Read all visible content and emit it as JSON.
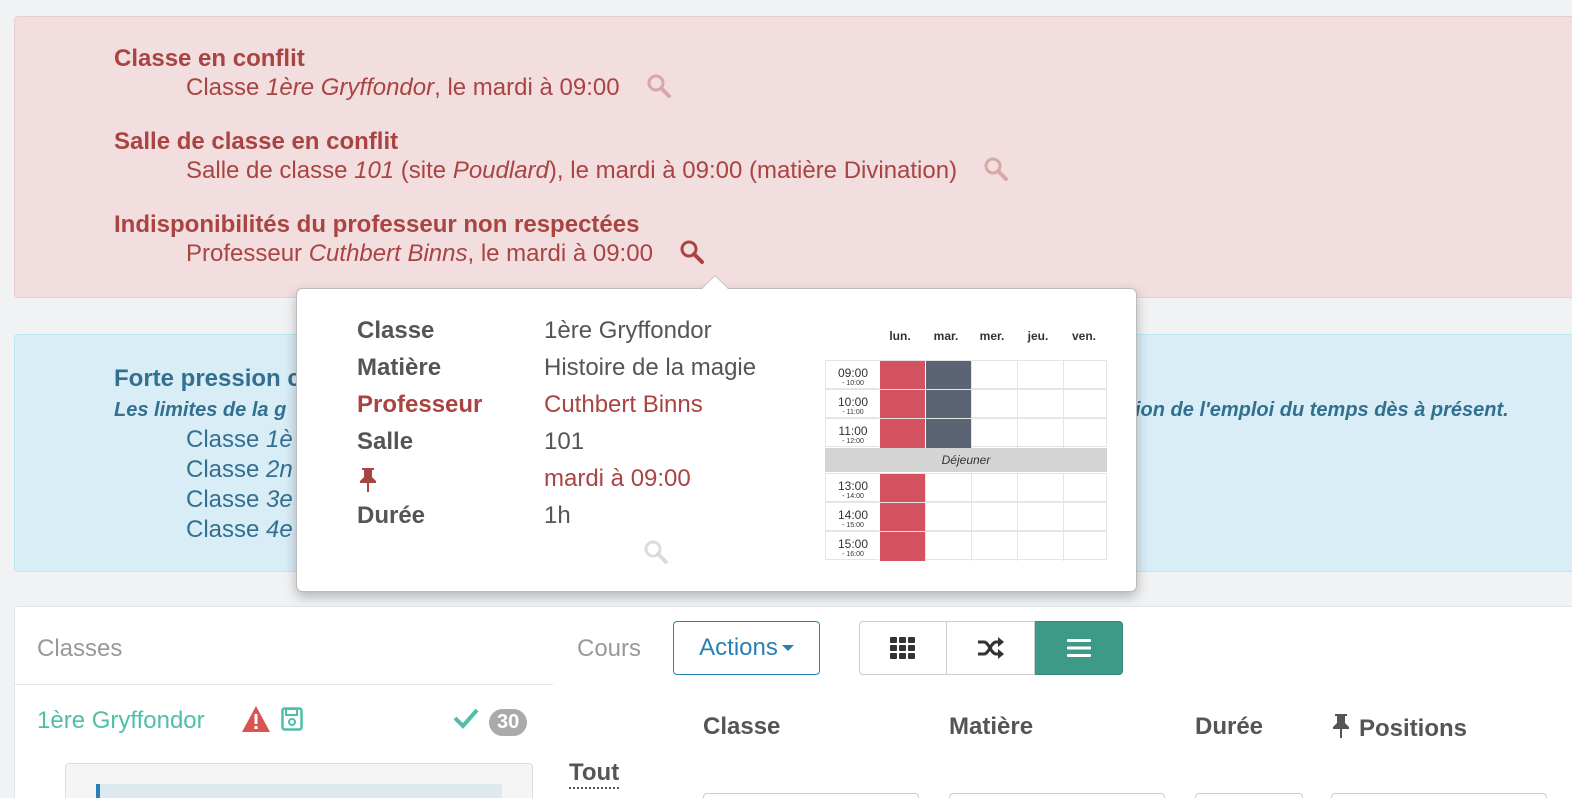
{
  "conflicts": [
    {
      "title": "Classe en conflit",
      "prefix": "Classe ",
      "em1": "1ère Gryffondor",
      "mid": "",
      "em2": "",
      "suffix": ", le mardi à 09:00",
      "search_active": false
    },
    {
      "title": "Salle de classe en conflit",
      "prefix": "Salle de classe ",
      "em1": "101",
      "mid": " (site ",
      "em2": "Poudlard",
      "suffix": "), le mardi à 09:00 (matière Divination)",
      "search_active": false
    },
    {
      "title": "Indisponibilités du professeur non respectées",
      "prefix": "Professeur ",
      "em1": "Cuthbert Binns",
      "mid": "",
      "em2": "",
      "suffix": ", le mardi à 09:00",
      "search_active": true
    }
  ],
  "info": {
    "title": "Forte pression c",
    "italic_left": "Les limites de la g",
    "italic_right": "ion de l'emploi du temps dès à présent.",
    "lines": [
      {
        "prefix": "Classe ",
        "em": "1è"
      },
      {
        "prefix": "Classe ",
        "em": "2n"
      },
      {
        "prefix": "Classe ",
        "em": "3e"
      },
      {
        "prefix": "Classe ",
        "em": "4e"
      }
    ]
  },
  "popover": {
    "rows": [
      {
        "key": "Classe",
        "value": "1ère Gryffondor",
        "highlight": false
      },
      {
        "key": "Matière",
        "value": "Histoire de la magie",
        "highlight": false
      },
      {
        "key": "Professeur",
        "value": "Cuthbert Binns",
        "highlight": true
      },
      {
        "key": "Salle",
        "value": "101",
        "highlight": false
      },
      {
        "key": "",
        "value": "mardi à 09:00",
        "highlight": true,
        "icon": "pin-icon"
      },
      {
        "key": "Durée",
        "value": "1h",
        "highlight": false
      }
    ],
    "timetable": {
      "days": [
        "lun.",
        "mar.",
        "mer.",
        "jeu.",
        "ven."
      ],
      "morning": [
        {
          "time": "09:00",
          "sub": "- 10:00",
          "cells": [
            "red",
            "gray",
            "",
            "",
            ""
          ]
        },
        {
          "time": "10:00",
          "sub": "- 11:00",
          "cells": [
            "red",
            "gray",
            "",
            "",
            ""
          ]
        },
        {
          "time": "11:00",
          "sub": "- 12:00",
          "cells": [
            "red",
            "gray",
            "",
            "",
            ""
          ]
        }
      ],
      "lunch": "Déjeuner",
      "afternoon": [
        {
          "time": "13:00",
          "sub": "- 14:00",
          "cells": [
            "red",
            "",
            "",
            "",
            ""
          ]
        },
        {
          "time": "14:00",
          "sub": "- 15:00",
          "cells": [
            "red",
            "",
            "",
            "",
            ""
          ]
        },
        {
          "time": "15:00",
          "sub": "- 16:00",
          "cells": [
            "red",
            "",
            "",
            "",
            ""
          ]
        }
      ]
    }
  },
  "panel": {
    "classes_label": "Classes",
    "cours_label": "Cours",
    "actions_label": "Actions",
    "view_buttons": [
      "grid-icon",
      "shuffle-icon",
      "list-icon"
    ],
    "active_view": "list-icon",
    "class_item": {
      "name": "1ère Gryffondor",
      "count": "30"
    },
    "table_headers": {
      "classe": "Classe",
      "matiere": "Matière",
      "duree": "Durée",
      "positions": "Positions"
    },
    "filter_all": "Tout"
  },
  "colors": {
    "danger": "#a94442",
    "danger_bg": "#f2dede",
    "info": "#31708f",
    "info_bg": "#d9edf7",
    "teal": "#3d9a86",
    "primary": "#2a7fb4",
    "event_red": "#d45260",
    "event_gray": "#5a6473"
  }
}
